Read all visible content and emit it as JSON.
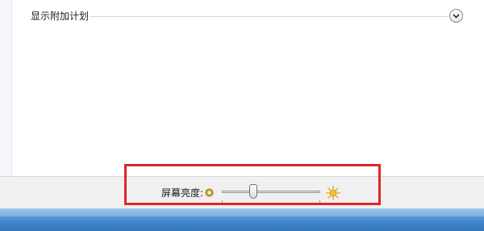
{
  "section": {
    "title": "显示附加计划",
    "expand_icon": "chevron-down-icon"
  },
  "brightness": {
    "label": "屏幕亮度:",
    "level_percent": 32,
    "dim_icon": "sun-dim-icon",
    "bright_icon": "sun-bright-icon"
  },
  "colors": {
    "highlight": "#e0262b",
    "taskbar": "#4a8fd1"
  }
}
